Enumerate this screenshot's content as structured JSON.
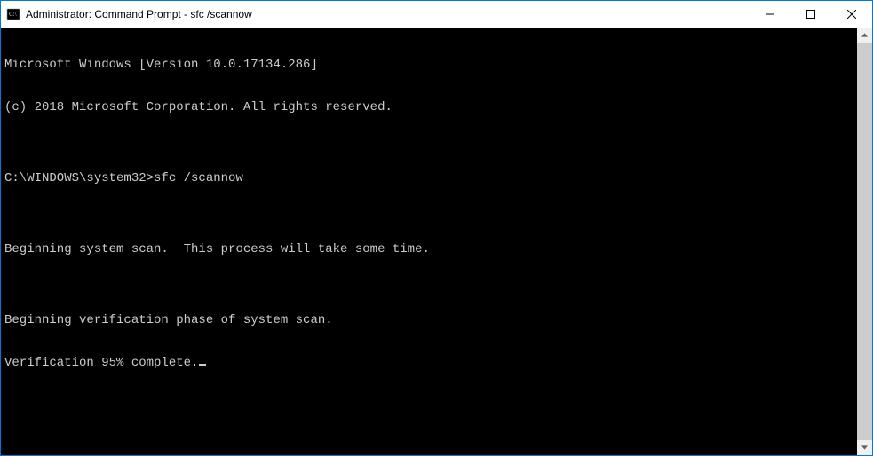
{
  "window": {
    "title": "Administrator: Command Prompt - sfc  /scannow"
  },
  "terminal": {
    "lines": [
      "Microsoft Windows [Version 10.0.17134.286]",
      "(c) 2018 Microsoft Corporation. All rights reserved.",
      "",
      "C:\\WINDOWS\\system32>sfc /scannow",
      "",
      "Beginning system scan.  This process will take some time.",
      "",
      "Beginning verification phase of system scan.",
      "Verification 95% complete."
    ],
    "prompt_path": "C:\\WINDOWS\\system32>",
    "command": "sfc /scannow",
    "progress_percent": 95
  }
}
